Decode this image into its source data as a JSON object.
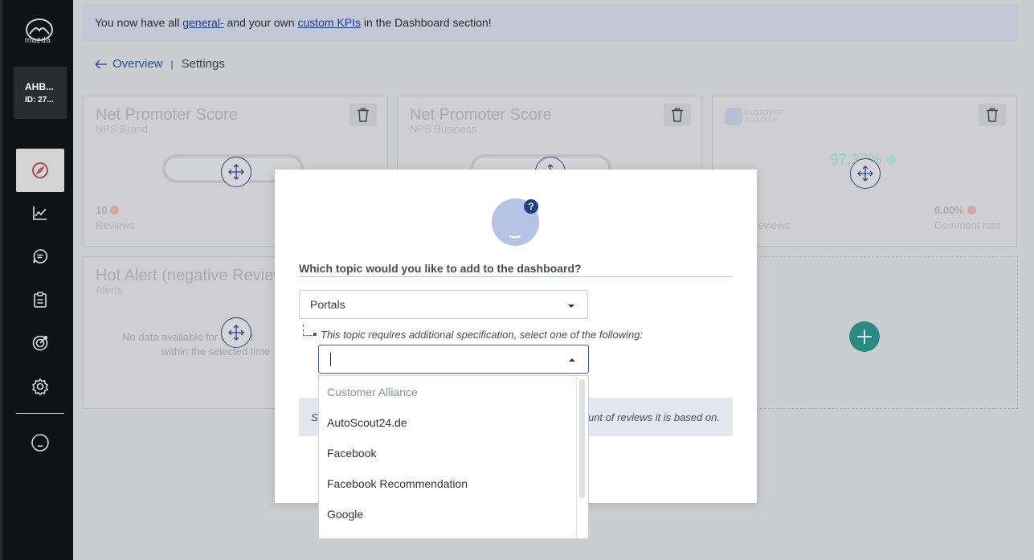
{
  "sidebar": {
    "brand": "mazda",
    "account_name": "AHB...",
    "account_id": "ID: 27...",
    "nav": [
      {
        "icon": "compass-icon",
        "active": true
      },
      {
        "icon": "trend-chart-icon",
        "active": false
      },
      {
        "icon": "chat-bubble-icon",
        "active": false
      },
      {
        "icon": "clipboard-icon",
        "active": false
      },
      {
        "icon": "target-icon",
        "active": false
      },
      {
        "icon": "gear-icon",
        "active": false
      },
      {
        "icon": "smiley-icon",
        "active": false
      }
    ]
  },
  "banner": {
    "prefix": "You now have all ",
    "link1": "general-",
    "middle": " and your own ",
    "link2": "custom KPIs",
    "suffix": " in the Dashboard section!"
  },
  "breadcrumb": {
    "back_label": "Overview",
    "separator": "|",
    "current": "Settings"
  },
  "cards": [
    {
      "title": "Net Promoter Score",
      "subtitle": "NPS Brand",
      "count": "10",
      "count_label": "Reviews"
    },
    {
      "title": "Net Promoter Score",
      "subtitle": "NPS Business"
    },
    {
      "brand_line1": "CUSTOMER",
      "brand_line2": "ALLIANCE",
      "value": "97.37%",
      "left_label": "Reviews",
      "rate": "0.00%",
      "rate_label": "Comment rate"
    },
    {
      "title": "Hot Alert (negative Reviews",
      "subtitle": "Alerts",
      "empty_line1": "No data available for current",
      "empty_line2": "within the selected time"
    }
  ],
  "modal": {
    "help_badge": "?",
    "question": "Which topic would you like to add to the dashboard?",
    "topic_value": "Portals",
    "spec_text": "This topic requires additional specification, select one of the following:",
    "info_left": "S",
    "info_right": "ount of reviews it is based on."
  },
  "dropdown": {
    "options": [
      {
        "label": "Customer Alliance",
        "disabled": true
      },
      {
        "label": "AutoScout24.de",
        "disabled": false
      },
      {
        "label": "Facebook",
        "disabled": false
      },
      {
        "label": "Facebook Recommendation",
        "disabled": false
      },
      {
        "label": "Google",
        "disabled": false
      }
    ]
  },
  "colors": {
    "sidebar_bg": "#111214",
    "accent_navy": "#233f88",
    "add_button": "#2a8a83",
    "link": "#1f3a8a"
  }
}
